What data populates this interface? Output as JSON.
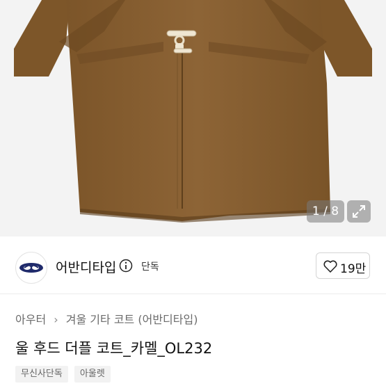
{
  "gallery": {
    "counter": "1 / 8",
    "image_alt": "camel wool hooded duffle coat"
  },
  "brand": {
    "name": "어반디타입",
    "badge": "단독",
    "likes": "19만"
  },
  "breadcrumb": [
    "아우터",
    "겨울 기타 코트",
    "(어반디타입)"
  ],
  "product": {
    "title": "울 후드 더플 코트_카멜_OL232",
    "tags": [
      "무신사단독",
      "아울렛"
    ]
  },
  "colors": {
    "coat": "#8a6234",
    "accent_navy": "#1f2a6b"
  }
}
